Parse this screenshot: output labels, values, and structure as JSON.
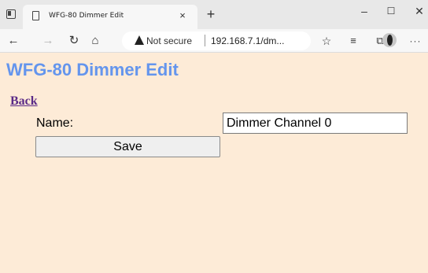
{
  "browser": {
    "tab": {
      "title": "WFG-80 Dimmer Edit",
      "close_glyph": "×"
    },
    "new_tab_glyph": "+",
    "window_controls": {
      "minimize": "–",
      "maximize": "☐",
      "close": "✕"
    },
    "toolbar": {
      "back_glyph": "←",
      "forward_glyph": "→",
      "reload_glyph": "↻",
      "home_glyph": "⌂",
      "favorite_glyph": "☆",
      "favorites_list_glyph": "≡",
      "collections_glyph": "⧉",
      "menu_glyph": "···"
    },
    "address_bar": {
      "security_label": "Not secure",
      "url": "192.168.7.1/dm..."
    }
  },
  "page": {
    "background": "#fdebd7",
    "title": "WFG-80 Dimmer Edit",
    "title_color": "#6495ed",
    "back_link": "Back",
    "form": {
      "name_label": "Name:",
      "name_value": "Dimmer Channel 0",
      "save_label": "Save"
    }
  }
}
